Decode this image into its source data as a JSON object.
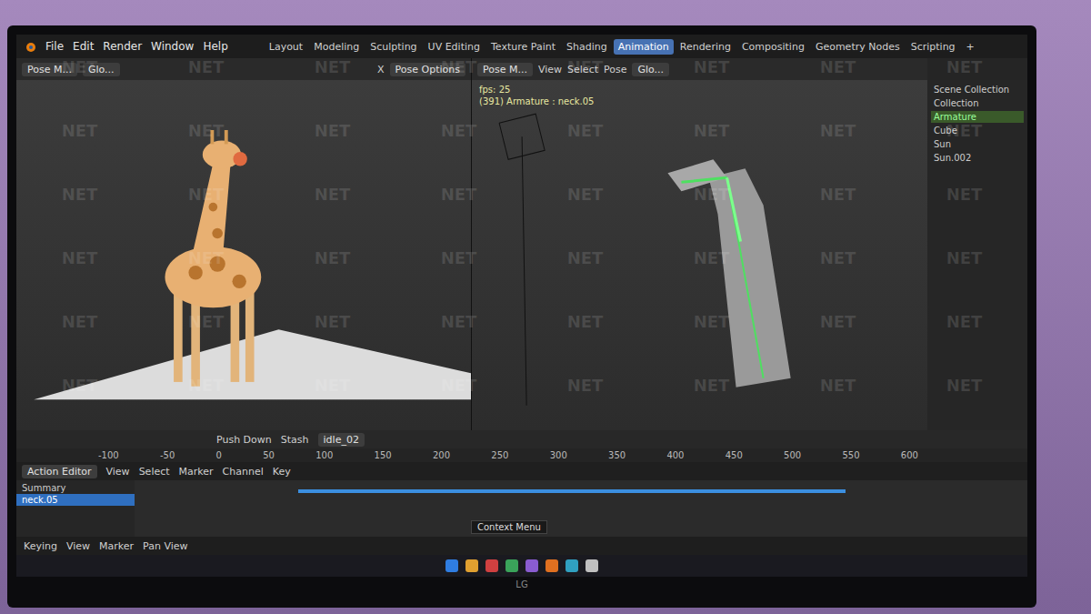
{
  "window": {
    "app": "Blender"
  },
  "menus": [
    "File",
    "Edit",
    "Render",
    "Window",
    "Help"
  ],
  "workspaces": [
    {
      "label": "Layout",
      "selected": false
    },
    {
      "label": "Modeling",
      "selected": false
    },
    {
      "label": "Sculpting",
      "selected": false
    },
    {
      "label": "UV Editing",
      "selected": false
    },
    {
      "label": "Texture Paint",
      "selected": false
    },
    {
      "label": "Shading",
      "selected": false
    },
    {
      "label": "Animation",
      "selected": true
    },
    {
      "label": "Rendering",
      "selected": false
    },
    {
      "label": "Compositing",
      "selected": false
    },
    {
      "label": "Geometry Nodes",
      "selected": false
    },
    {
      "label": "Scripting",
      "selected": false
    }
  ],
  "add_workspace": "+",
  "left_viewport": {
    "mode": "Pose M...",
    "view": "Glo...",
    "axis": "X",
    "options": "Pose Options"
  },
  "right_viewport": {
    "mode": "Pose M...",
    "menus": [
      "View",
      "Select",
      "Pose"
    ],
    "view": "Glo...",
    "overlay": [
      "fps: 25",
      "(391) Armature : neck.05"
    ]
  },
  "outliner": {
    "items": [
      {
        "label": "Scene Collection",
        "selected": false
      },
      {
        "label": "Collection",
        "selected": false
      },
      {
        "label": "Armature",
        "selected": true
      },
      {
        "label": "Cube",
        "selected": false
      },
      {
        "label": "Sun",
        "selected": false
      },
      {
        "label": "Sun.002",
        "selected": false
      }
    ]
  },
  "nla": {
    "buttons": [
      "Push Down",
      "Stash"
    ],
    "action": "idle_02"
  },
  "ruler": [
    "-100",
    "-50",
    "0",
    "50",
    "100",
    "150",
    "200",
    "250",
    "300",
    "350",
    "400",
    "450",
    "500",
    "550",
    "600"
  ],
  "action_editor": {
    "title": "Action Editor",
    "menus": [
      "View",
      "Select",
      "Marker",
      "Channel",
      "Key"
    ],
    "channels": [
      {
        "label": "Summary",
        "selected": false
      },
      {
        "label": "neck.05",
        "selected": true
      }
    ]
  },
  "footer": {
    "menus": [
      "Keying",
      "View",
      "Marker"
    ],
    "hint": "Pan View",
    "tooltip": "Context Menu"
  },
  "taskbar": [
    {
      "color": "#2f7de1"
    },
    {
      "color": "#e0a030"
    },
    {
      "color": "#d04040"
    },
    {
      "color": "#3aa35a"
    },
    {
      "color": "#8a5cd0"
    },
    {
      "color": "#e07020"
    },
    {
      "color": "#30a0c0"
    },
    {
      "color": "#c0c0c0"
    }
  ],
  "monitor": {
    "brand": "LG"
  },
  "watermark": "NET"
}
